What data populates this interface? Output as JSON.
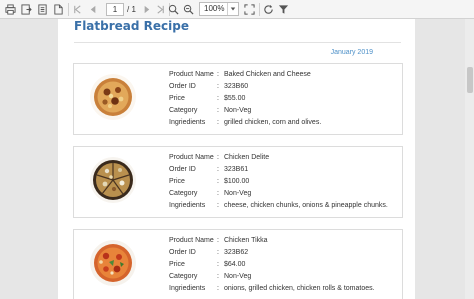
{
  "toolbar": {
    "current_page": "1",
    "total_pages": "/ 1",
    "zoom": "100%",
    "icons": [
      "print-icon",
      "export-icon",
      "page-setup-icon",
      "document-icon",
      "first-page-icon",
      "previous-page-icon",
      "next-page-icon",
      "last-page-icon",
      "zoom-in-icon",
      "zoom-out-icon",
      "fit-page-icon",
      "refresh-icon",
      "filter-icon"
    ]
  },
  "report": {
    "title": "Flatbread Recipe",
    "date": "January 2019",
    "accent_color": "#3a70a8",
    "date_color": "#4d90c8",
    "labels": {
      "product_name": "Product Name",
      "order_id": "Order ID",
      "price": "Price",
      "category": "Category",
      "ingredients": "Ingriedients",
      "separator": ":"
    },
    "items": [
      {
        "product_name": "Baked Chicken and Cheese",
        "order_id": "323B60",
        "price": "$55.00",
        "category": "Non-Veg",
        "ingredients": "grilled chicken, corn and olives."
      },
      {
        "product_name": "Chicken Delite",
        "order_id": "323B61",
        "price": "$100.00",
        "category": "Non-Veg",
        "ingredients": "cheese, chicken chunks, onions & pineapple chunks."
      },
      {
        "product_name": "Chicken Tikka",
        "order_id": "323B62",
        "price": "$64.00",
        "category": "Non-Veg",
        "ingredients": "onions, grilled chicken, chicken rolls & tomatoes."
      }
    ]
  }
}
